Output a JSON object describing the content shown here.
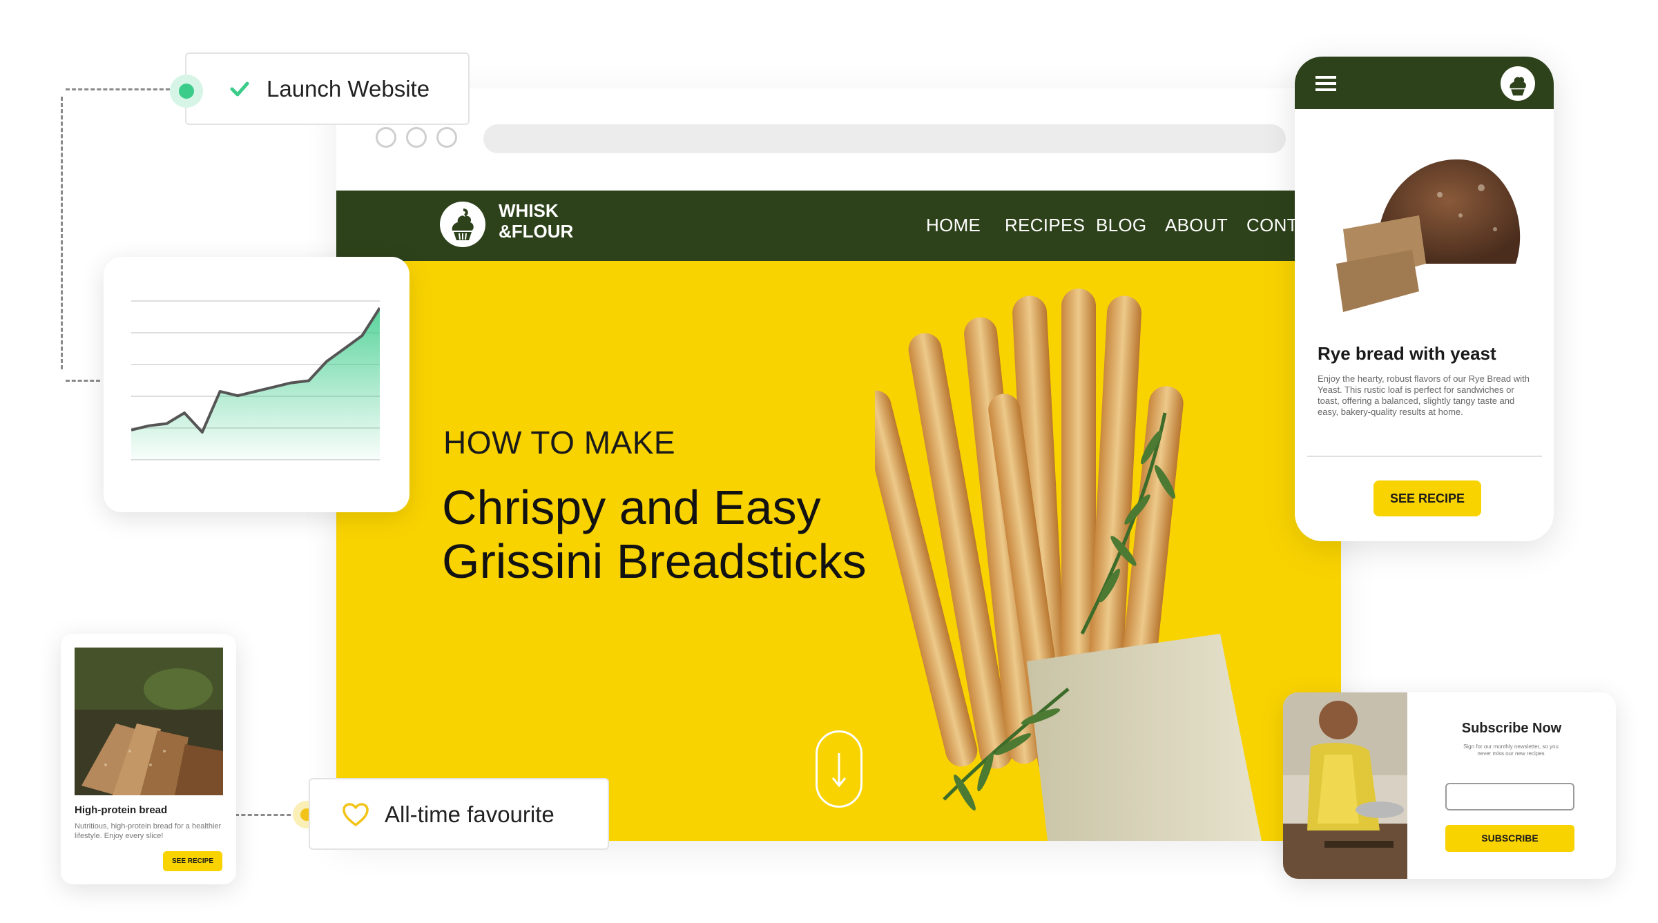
{
  "tasks": {
    "launch_label": "Launch Website",
    "favourite_label": "All-time favourite"
  },
  "site": {
    "brand_line1": "WHISK",
    "brand_line2": "&FLOUR",
    "nav": [
      "HOME",
      "RECIPES",
      "BLOG",
      "ABOUT",
      "CONTA"
    ],
    "hero_kicker": "HOW TO MAKE",
    "hero_title_line1": "Chrispy and Easy",
    "hero_title_line2": "Grissini Breadsticks"
  },
  "phone_card": {
    "title": "Rye bread with yeast",
    "description": "Enjoy the hearty, robust flavors of our Rye Bread with Yeast. This rustic loaf is perfect for sandwiches or toast, offering a balanced, slightly tangy taste and easy, bakery-quality results at home.",
    "button": "SEE RECIPE"
  },
  "mini_card": {
    "title": "High-protein bread",
    "description": "Nutritious, high-protein bread for a healthier lifestyle. Enjoy every slice!",
    "button": "SEE RECIPE"
  },
  "subscribe": {
    "title": "Subscribe Now",
    "description": "Sign for our monthly newsletter, so you never miss our new recipes",
    "input_placeholder": "",
    "button": "SUBSCRIBE"
  },
  "trend_chart": {
    "points": [
      0,
      2,
      3,
      8,
      -1,
      18,
      16,
      18,
      20,
      22,
      23,
      32,
      38,
      44,
      57
    ]
  },
  "colors": {
    "brand_green": "#2d421b",
    "brand_yellow": "#f9d300",
    "check_green": "#3ccc8a",
    "heart_yellow": "#f2c318"
  },
  "icons": [
    "check-icon",
    "heart-icon",
    "hamburger-menu-icon",
    "cupcake-logo-icon",
    "arrow-down-icon"
  ]
}
